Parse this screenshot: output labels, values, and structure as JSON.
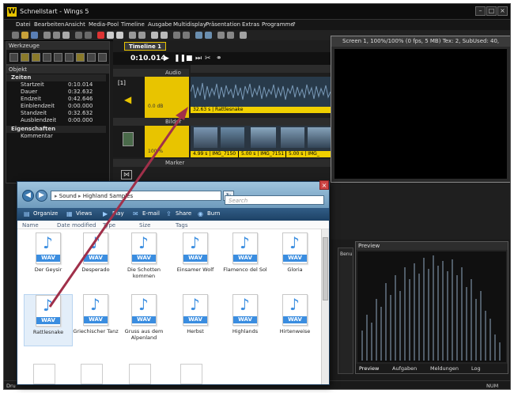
{
  "app": {
    "title": "Schnellstart - Wings 5",
    "logo": "W",
    "window_controls": [
      "–",
      "□",
      "×"
    ]
  },
  "menu": [
    "Datei",
    "Bearbeiten",
    "Ansicht",
    "Media-Pool",
    "Timeline",
    "Ausgabe",
    "Multidisplay",
    "Präsentation",
    "Extras",
    "Programme",
    "?"
  ],
  "left_panel": {
    "tools_title": "Werkzeuge",
    "object_title": "Objekt",
    "section_times": "Zeiten",
    "rows": [
      {
        "k": "Startzeit",
        "v": "0:10.014"
      },
      {
        "k": "Dauer",
        "v": "0:32.632"
      },
      {
        "k": "Endzeit",
        "v": "0:42.646"
      },
      {
        "k": "Einblendzeit",
        "v": "0:00.000"
      },
      {
        "k": "Standzeit",
        "v": "0:32.632"
      },
      {
        "k": "Ausblendzeit",
        "v": "0:00.000"
      }
    ],
    "section_props": "Eigenschaften",
    "comment": "Kommentar"
  },
  "timeline": {
    "tab": "Timeline 1",
    "timecode": "0:10.014",
    "track_audio": "Audio",
    "track_num": "[1]",
    "db_label": "0.0 dB",
    "audio_clip": "32.63 s | Rattlesnake",
    "track_images": "Bilder",
    "pct_label": "100 %",
    "image_clips": [
      "4.99 s | IMG_7150",
      "5.00 s | IMG_7151",
      "5.00 s | IMG_"
    ],
    "track_marker": "Marker"
  },
  "screen": {
    "title": "Screen 1, 100%/100% (0 fps, 5 MB)  Tex: 2, SubUsed: 40, M..."
  },
  "preview": {
    "title": "Preview",
    "tabs": [
      "Preview",
      "Aufgaben",
      "Meldungen",
      "Log"
    ],
    "side_label": "Benu"
  },
  "status": {
    "left": "Dru",
    "right": "NUM"
  },
  "explorer": {
    "address": [
      "Sound",
      "Highland Samples"
    ],
    "search_placeholder": "Search",
    "commands": [
      "Organize",
      "Views",
      "Play",
      "E-mail",
      "Share",
      "Burn"
    ],
    "columns": [
      "Name",
      "Date modified",
      "Type",
      "Size",
      "Tags"
    ],
    "file_ext": "WAV",
    "files": [
      "Der Geysir",
      "Desperado",
      "Die Schotten kommen",
      "Einsamer Wolf",
      "Flamenco del Sol",
      "Gloria",
      "Rattlesnake",
      "Griechischer Tanz",
      "Gruss aus dem Alpenland",
      "Herbst",
      "Highlands",
      "Hirtenweise"
    ],
    "selected": "Rattlesnake"
  },
  "colors": {
    "accent": "#f0d000",
    "waveform": "#7a9ab8",
    "explorer_bar": "#1d4266",
    "arrow": "#a0304a"
  }
}
